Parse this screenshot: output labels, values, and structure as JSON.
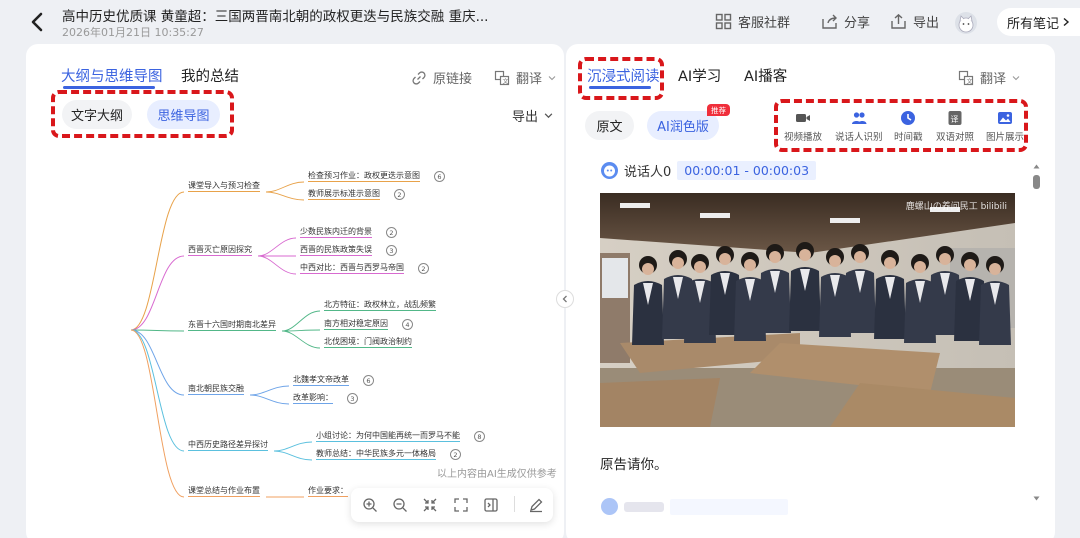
{
  "header": {
    "title": "高中历史优质课 黄童超：三国两晋南北朝的政权更迭与民族交融 重庆...",
    "date": "2026年01月21日 10:35:27",
    "actions": [
      {
        "label": "客服社群",
        "icon": "grid-icon"
      },
      {
        "label": "分享",
        "icon": "share-icon"
      },
      {
        "label": "导出",
        "icon": "export-icon"
      }
    ],
    "all_notes": "所有笔记"
  },
  "left": {
    "tabs": [
      "大纲与思维导图",
      "我的总结"
    ],
    "tools": {
      "link": "原链接",
      "translate": "翻译"
    },
    "views": [
      "文字大纲",
      "思维导图"
    ],
    "export": "导出",
    "mindmap": {
      "branches": [
        {
          "label": "课堂导入与预习检查",
          "children": [
            {
              "label": "检查预习作业：政权更迭示意图",
              "count": "6"
            },
            {
              "label": "教师展示标准示意图",
              "count": "2"
            }
          ]
        },
        {
          "label": "西晋灭亡原因探究",
          "children": [
            {
              "label": "少数民族内迁的背景",
              "count": "2"
            },
            {
              "label": "西晋的民族政策失误",
              "count": "3"
            },
            {
              "label": "中西对比：西晋与西罗马帝国",
              "count": "2"
            }
          ]
        },
        {
          "label": "东晋十六国时期南北差异",
          "children": [
            {
              "label": "北方特征：政权林立，战乱频繁",
              "count": ""
            },
            {
              "label": "南方相对稳定原因",
              "count": "4"
            },
            {
              "label": "北伐困境：门阀政治制约",
              "count": ""
            }
          ]
        },
        {
          "label": "南北朝民族交融",
          "children": [
            {
              "label": "北魏孝文帝改革",
              "count": "6"
            },
            {
              "label": "改革影响：",
              "count": "3"
            }
          ]
        },
        {
          "label": "中西历史路径差异探讨",
          "children": [
            {
              "label": "小组讨论：为何中国能再统一而罗马不能",
              "count": "8"
            },
            {
              "label": "教师总结：中华民族多元一体格局",
              "count": "2"
            }
          ]
        },
        {
          "label": "课堂总结与作业布置",
          "children": [
            {
              "label": "作业要求：",
              "count": ""
            }
          ]
        }
      ]
    },
    "disclaimer": "以上内容由AI生成仅供参考",
    "zoom_tools": [
      "zoom-in-icon",
      "zoom-out-icon",
      "collapse-icon",
      "fullscreen-icon",
      "sidebar-icon",
      "edit-icon"
    ]
  },
  "right": {
    "tabs": [
      "沉浸式阅读",
      "AI学习",
      "AI播客"
    ],
    "translate": "翻译",
    "versions": [
      "原文",
      "AI润色版"
    ],
    "new_badge": "推荐",
    "video_tools": [
      {
        "label": "视频播放",
        "icon": "video-icon"
      },
      {
        "label": "说话人识别",
        "icon": "people-icon"
      },
      {
        "label": "时间戳",
        "icon": "clock-icon"
      },
      {
        "label": "双语对照",
        "icon": "translate-icon"
      },
      {
        "label": "图片展示",
        "icon": "image-icon"
      }
    ],
    "segments": [
      {
        "speaker": "说话人0",
        "time": "00:00:01 - 00:00:03",
        "text": "原告请你。"
      }
    ],
    "watermark": "鹿螺山の养问民工 bilibili"
  },
  "colors": {
    "accent": "#3b63e0",
    "highlight_box": "#d9171b",
    "mm_branches": [
      "#e8a24a",
      "#d86ad0",
      "#52b788",
      "#6ea4e8",
      "#5bc0de",
      "#f0a060"
    ]
  }
}
